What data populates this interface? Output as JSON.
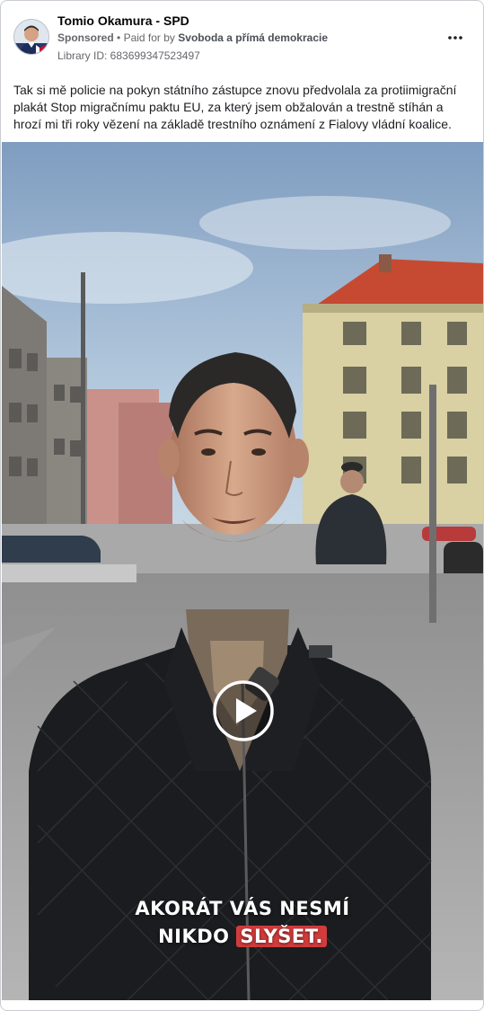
{
  "ad": {
    "page_name": "Tomio Okamura - SPD",
    "sponsored_label": "Sponsored",
    "separator": "•",
    "paid_for_prefix": "Paid for by",
    "payer": "Svoboda a přímá demokracie",
    "library_id": "Library ID: 683699347523497",
    "more_icon": "more-horizontal-icon",
    "body_text": "Tak si mě policie na pokyn státního zástupce znovu předvolala za protiimigrační plakát Stop migračnímu paktu EU, za který jsem obžalován a trestně stíhán a hrozí mi tři roky vězení na základě trestního oznámení z Fialovy vládní koalice."
  },
  "video": {
    "play_icon": "play-icon",
    "caption_line1": "AKORÁT VÁS NESMÍ",
    "caption_line2_prefix": "NIKDO",
    "caption_line2_highlight": "SLYŠET.",
    "highlight_color": "#d23c3c"
  }
}
